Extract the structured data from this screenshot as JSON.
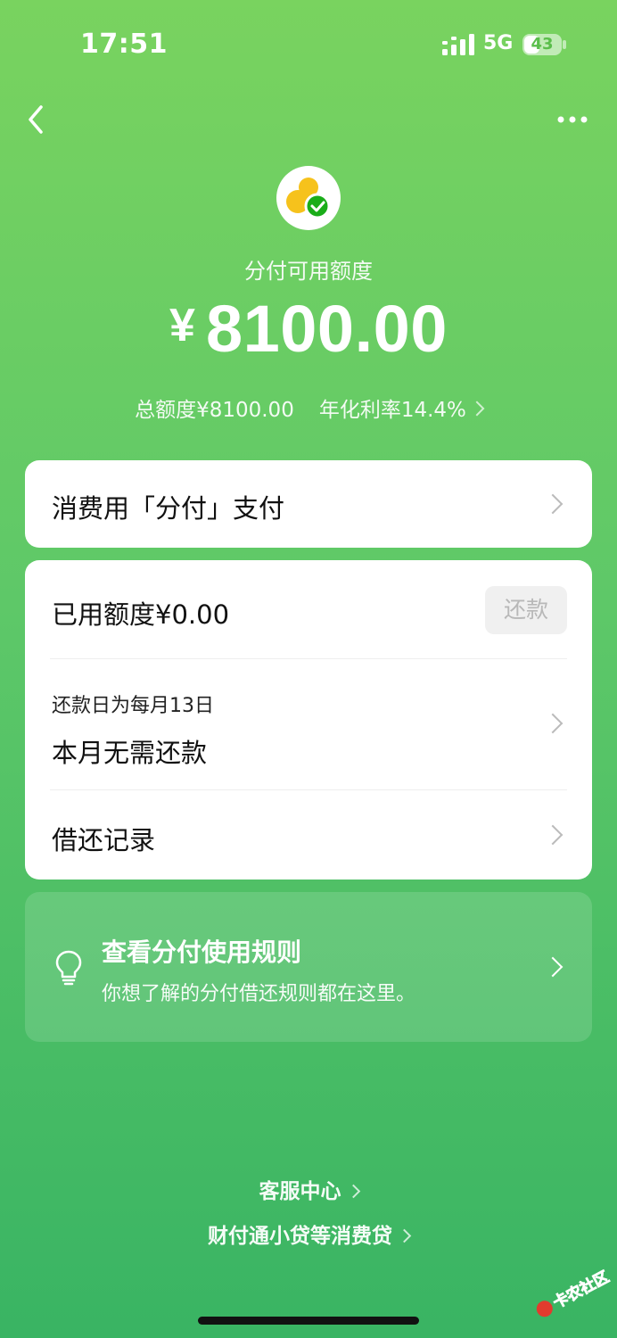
{
  "status_bar": {
    "time": "17:51",
    "network": "5G",
    "battery": "43",
    "battery_level": 43
  },
  "nav": {
    "back_icon": "chevron-left-icon",
    "more_icon": "more-dots-icon"
  },
  "hero": {
    "logo_icon": "fenfu-logo-icon",
    "label": "分付可用额度",
    "currency": "¥",
    "amount": "8100.00",
    "total_limit": "总额度¥8100.00",
    "annual_rate": "年化利率14.4%"
  },
  "pay_card": {
    "label": "消费用「分付」支付"
  },
  "account_card": {
    "used_amount": "已用额度¥0.00",
    "repay_button": "还款",
    "repay_date": "还款日为每月13日",
    "repay_status": "本月无需还款",
    "records_label": "借还记录"
  },
  "rules_card": {
    "icon": "lightbulb-icon",
    "title": "查看分付使用规则",
    "subtitle": "你想了解的分付借还规则都在这里。"
  },
  "footer": {
    "service_center": "客服中心",
    "consumer_loans": "财付通小贷等消费贷"
  },
  "watermark": {
    "text": "卡农社区"
  },
  "colors": {
    "gradient_top": "#79d35f",
    "gradient_bottom": "#39b463",
    "logo_yellow": "#f6c21c",
    "logo_green": "#1aad19"
  }
}
